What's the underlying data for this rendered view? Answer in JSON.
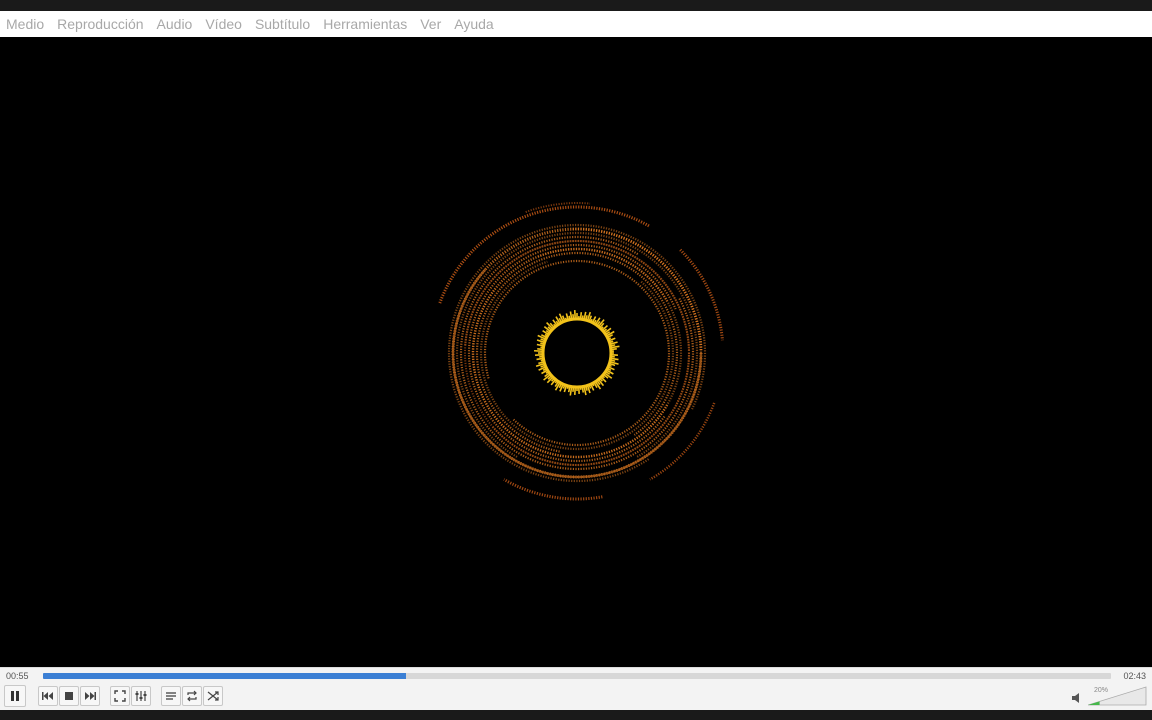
{
  "menu": {
    "items": [
      "Medio",
      "Reproducción",
      "Audio",
      "Vídeo",
      "Subtítulo",
      "Herramientas",
      "Ver",
      "Ayuda"
    ]
  },
  "player": {
    "time_elapsed": "00:55",
    "time_total": "02:43",
    "progress": 0.34,
    "volume_label": "20%",
    "volume": 0.2,
    "state": "playing"
  },
  "colors": {
    "accent": "#3b7fd4",
    "ring_outer": "#c75a16",
    "ring_mid": "#e07a22",
    "ring_inner": "#f2c21a"
  },
  "icons": {
    "pause": "pause-icon",
    "previous": "previous-icon",
    "stop": "stop-icon",
    "next": "next-icon",
    "fullscreen": "fullscreen-icon",
    "extended": "extended-settings-icon",
    "playlist": "playlist-icon",
    "loop": "loop-icon",
    "shuffle": "shuffle-icon",
    "volume": "volume-icon"
  }
}
